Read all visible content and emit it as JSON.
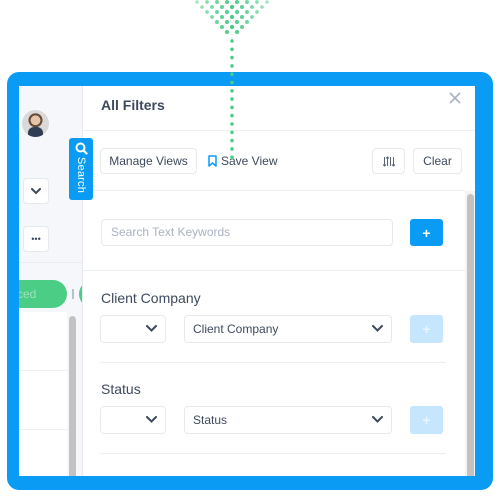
{
  "panel": {
    "title": "All Filters",
    "close_icon": "close-icon"
  },
  "toolbar": {
    "manage_views_label": "Manage Views",
    "save_view_label": "Save View",
    "save_view_icon": "bookmark-icon",
    "sort_icon": "sort-arrows-icon",
    "clear_label": "Clear"
  },
  "search_tab": {
    "label": "Search",
    "icon": "search-icon"
  },
  "keyword_search": {
    "placeholder": "Search Text Keywords",
    "add_label": "+"
  },
  "filters": [
    {
      "label": "Client Company",
      "operator_value": "",
      "field_value": "Client Company",
      "add_label": "+",
      "add_enabled": false
    },
    {
      "label": "Status",
      "operator_value": "",
      "field_value": "Status",
      "add_label": "+",
      "add_enabled": false
    }
  ],
  "background_app": {
    "more_label": "•••",
    "pill_text": "ced",
    "pill_color": "#4ccd86"
  },
  "colors": {
    "accent": "#0a9cf5",
    "accent_disabled": "#c6e6fd",
    "dots": "#4ccd86"
  }
}
